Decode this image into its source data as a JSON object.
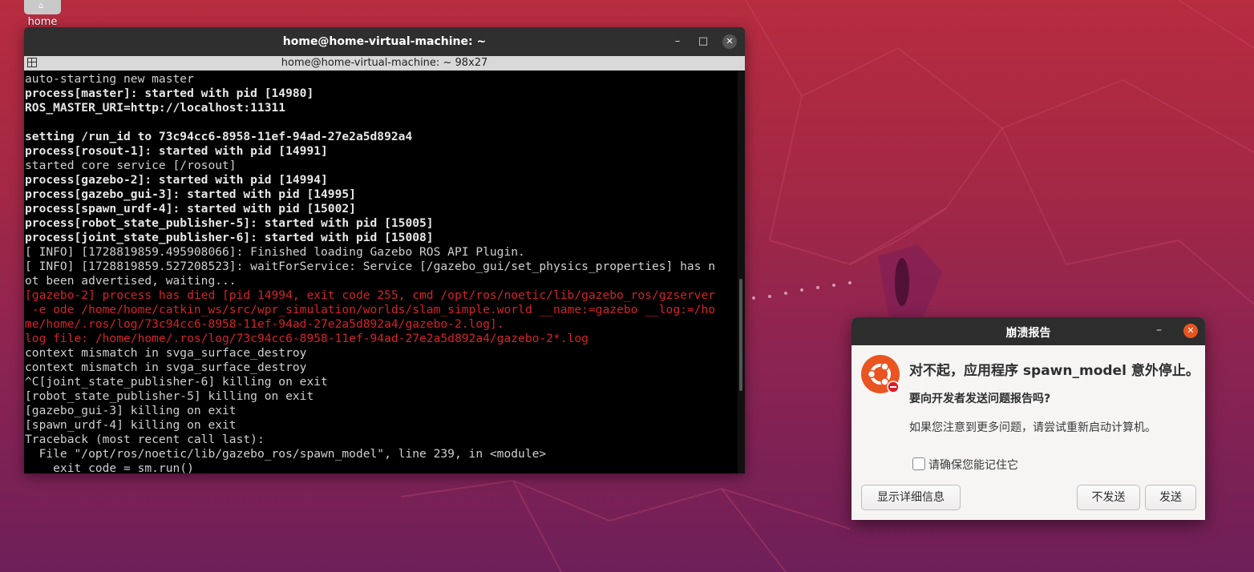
{
  "desktop": {
    "icon_label": "home"
  },
  "terminal": {
    "title": "home@home-virtual-machine: ~",
    "subtitle": "home@home-virtual-machine: ~ 98x27",
    "lines": [
      {
        "text": "auto-starting new master",
        "style": "normal"
      },
      {
        "text": "process[master]: started with pid [14980]",
        "style": "bold"
      },
      {
        "text": "ROS_MASTER_URI=http://localhost:11311",
        "style": "bold"
      },
      {
        "text": "",
        "style": "normal"
      },
      {
        "text": "setting /run_id to 73c94cc6-8958-11ef-94ad-27e2a5d892a4",
        "style": "bold"
      },
      {
        "text": "process[rosout-1]: started with pid [14991]",
        "style": "bold"
      },
      {
        "text": "started core service [/rosout]",
        "style": "normal"
      },
      {
        "text": "process[gazebo-2]: started with pid [14994]",
        "style": "bold"
      },
      {
        "text": "process[gazebo_gui-3]: started with pid [14995]",
        "style": "bold"
      },
      {
        "text": "process[spawn_urdf-4]: started with pid [15002]",
        "style": "bold"
      },
      {
        "text": "process[robot_state_publisher-5]: started with pid [15005]",
        "style": "bold"
      },
      {
        "text": "process[joint_state_publisher-6]: started with pid [15008]",
        "style": "bold"
      },
      {
        "text": "[ INFO] [1728819859.495908066]: Finished loading Gazebo ROS API Plugin.",
        "style": "normal"
      },
      {
        "text": "[ INFO] [1728819859.527208523]: waitForService: Service [/gazebo_gui/set_physics_properties] has n",
        "style": "normal"
      },
      {
        "text": "ot been advertised, waiting...",
        "style": "normal"
      },
      {
        "text": "[gazebo-2] process has died [pid 14994, exit code 255, cmd /opt/ros/noetic/lib/gazebo_ros/gzserver",
        "style": "red"
      },
      {
        "text": " -e ode /home/home/catkin_ws/src/wpr_simulation/worlds/slam_simple.world __name:=gazebo __log:=/ho",
        "style": "red"
      },
      {
        "text": "me/home/.ros/log/73c94cc6-8958-11ef-94ad-27e2a5d892a4/gazebo-2.log].",
        "style": "red"
      },
      {
        "text": "log file: /home/home/.ros/log/73c94cc6-8958-11ef-94ad-27e2a5d892a4/gazebo-2*.log",
        "style": "red"
      },
      {
        "text": "context mismatch in svga_surface_destroy",
        "style": "normal"
      },
      {
        "text": "context mismatch in svga_surface_destroy",
        "style": "normal"
      },
      {
        "text": "^C[joint_state_publisher-6] killing on exit",
        "style": "normal"
      },
      {
        "text": "[robot_state_publisher-5] killing on exit",
        "style": "normal"
      },
      {
        "text": "[gazebo_gui-3] killing on exit",
        "style": "normal"
      },
      {
        "text": "[spawn_urdf-4] killing on exit",
        "style": "normal"
      },
      {
        "text": "Traceback (most recent call last):",
        "style": "normal"
      },
      {
        "text": "  File \"/opt/ros/noetic/lib/gazebo_ros/spawn_model\", line 239, in <module>",
        "style": "normal"
      },
      {
        "text": "    exit_code = sm.run()",
        "style": "normal"
      }
    ]
  },
  "dialog": {
    "title": "崩溃报告",
    "heading": "对不起，应用程序 spawn_model 意外停止。",
    "question": "要向开发者发送问题报告吗?",
    "hint": "如果您注意到更多问题，请尝试重新启动计算机。",
    "checkbox_label": "请确保您能记住它",
    "details_button": "显示详细信息",
    "dont_send_button": "不发送",
    "send_button": "发送"
  },
  "colors": {
    "accent_orange": "#e95420",
    "terminal_error_red": "#d3232a"
  }
}
